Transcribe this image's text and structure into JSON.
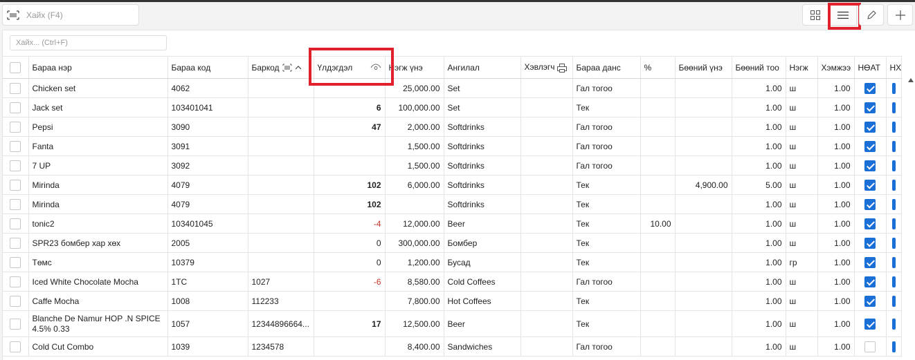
{
  "top_search": {
    "placeholder": "Хайх (F4)"
  },
  "filter": {
    "placeholder": "Хайх... (Ctrl+F)"
  },
  "toolbar": {
    "grid_view": "grid-icon",
    "list_view": "list-icon",
    "edit": "pencil-icon",
    "add": "plus-icon"
  },
  "colors": {
    "accent": "#1a6fd6",
    "highlight": "#e0202a",
    "negative": "#c0392b"
  },
  "columns": [
    "Бараа нэр",
    "Бараа код",
    "Баркод",
    "Үлдэгдэл",
    "Нэгж үнэ",
    "Ангилал",
    "Хэвлэгч",
    "Бараа данс",
    "%",
    "Бөөний үнэ",
    "Бөөний тоо",
    "Нэгж",
    "Хэмжээ",
    "НӨАТ",
    "НХ"
  ],
  "rows": [
    {
      "name": "Chicken set",
      "code": "4062",
      "barcode": "",
      "stock": "",
      "price": "25,000.00",
      "category": "Set",
      "printer": "",
      "account": "Гал тогоо",
      "percent": "",
      "wholesale_price": "",
      "wholesale_qty": "1.00",
      "unit": "ш",
      "size": "1.00",
      "vat": true
    },
    {
      "name": "Jack set",
      "code": "103401041",
      "barcode": "",
      "stock": "6",
      "price": "100,000.00",
      "category": "Set",
      "printer": "",
      "account": "Тек",
      "percent": "",
      "wholesale_price": "",
      "wholesale_qty": "1.00",
      "unit": "ш",
      "size": "1.00",
      "vat": true
    },
    {
      "name": "Pepsi",
      "code": "3090",
      "barcode": "",
      "stock": "47",
      "price": "2,000.00",
      "category": "Softdrinks",
      "printer": "",
      "account": "Гал тогоо",
      "percent": "",
      "wholesale_price": "",
      "wholesale_qty": "1.00",
      "unit": "ш",
      "size": "1.00",
      "vat": true
    },
    {
      "name": "Fanta",
      "code": "3091",
      "barcode": "",
      "stock": "",
      "price": "1,500.00",
      "category": "Softdrinks",
      "printer": "",
      "account": "Гал тогоо",
      "percent": "",
      "wholesale_price": "",
      "wholesale_qty": "1.00",
      "unit": "ш",
      "size": "1.00",
      "vat": true
    },
    {
      "name": "7 UP",
      "code": "3092",
      "barcode": "",
      "stock": "",
      "price": "1,500.00",
      "category": "Softdrinks",
      "printer": "",
      "account": "Гал тогоо",
      "percent": "",
      "wholesale_price": "",
      "wholesale_qty": "1.00",
      "unit": "ш",
      "size": "1.00",
      "vat": true
    },
    {
      "name": "Mirinda",
      "code": "4079",
      "barcode": "",
      "stock": "102",
      "price": "6,000.00",
      "category": "Softdrinks",
      "printer": "",
      "account": "Тек",
      "percent": "",
      "wholesale_price": "4,900.00",
      "wholesale_qty": "5.00",
      "unit": "ш",
      "size": "1.00",
      "vat": true
    },
    {
      "name": "Mirinda",
      "code": "4079",
      "barcode": "",
      "stock": "102",
      "price": "",
      "category": "Softdrinks",
      "printer": "",
      "account": "Тек",
      "percent": "",
      "wholesale_price": "",
      "wholesale_qty": "1.00",
      "unit": "ш",
      "size": "1.00",
      "vat": true
    },
    {
      "name": "tonic2",
      "code": "103401045",
      "barcode": "",
      "stock": "-4",
      "price": "12,000.00",
      "category": "Beer",
      "printer": "",
      "account": "Тек",
      "percent": "10.00",
      "wholesale_price": "",
      "wholesale_qty": "1.00",
      "unit": "ш",
      "size": "1.00",
      "vat": true
    },
    {
      "name": "SPR23 бомбер хар хөх",
      "code": "2005",
      "barcode": "",
      "stock": "0",
      "price": "300,000.00",
      "category": "Бомбер",
      "printer": "",
      "account": "Тек",
      "percent": "",
      "wholesale_price": "",
      "wholesale_qty": "1.00",
      "unit": "ш",
      "size": "1.00",
      "vat": true
    },
    {
      "name": "Төмс",
      "code": "10379",
      "barcode": "",
      "stock": "0",
      "price": "1,200.00",
      "category": "Бусад",
      "printer": "",
      "account": "Тек",
      "percent": "",
      "wholesale_price": "",
      "wholesale_qty": "1.00",
      "unit": "гр",
      "size": "1.00",
      "vat": true
    },
    {
      "name": "Iced White Chocolate Mocha",
      "code": "1TC",
      "barcode": "1027",
      "stock": "-6",
      "price": "8,580.00",
      "category": "Cold Coffees",
      "printer": "",
      "account": "Гал тогоо",
      "percent": "",
      "wholesale_price": "",
      "wholesale_qty": "1.00",
      "unit": "ш",
      "size": "1.00",
      "vat": true
    },
    {
      "name": "Caffe Mocha",
      "code": "1008",
      "barcode": "112233",
      "stock": "",
      "price": "7,800.00",
      "category": "Hot Coffees",
      "printer": "",
      "account": "Тек",
      "percent": "",
      "wholesale_price": "",
      "wholesale_qty": "1.00",
      "unit": "ш",
      "size": "1.00",
      "vat": true
    },
    {
      "name": "Blanche De Namur HOP .N SPICE 4.5% 0.33",
      "code": "1057",
      "barcode": "12344896664...",
      "stock": "17",
      "price": "12,500.00",
      "category": "Beer",
      "printer": "",
      "account": "Тек",
      "percent": "",
      "wholesale_price": "",
      "wholesale_qty": "1.00",
      "unit": "ш",
      "size": "1.00",
      "vat": true
    },
    {
      "name": "Cold Cut Combo",
      "code": "1039",
      "barcode": "1234578",
      "stock": "",
      "price": "8,400.00",
      "category": "Sandwiches",
      "printer": "",
      "account": "Гал тогоо",
      "percent": "",
      "wholesale_price": "",
      "wholesale_qty": "1.00",
      "unit": "ш",
      "size": "1.00",
      "vat": false
    }
  ]
}
